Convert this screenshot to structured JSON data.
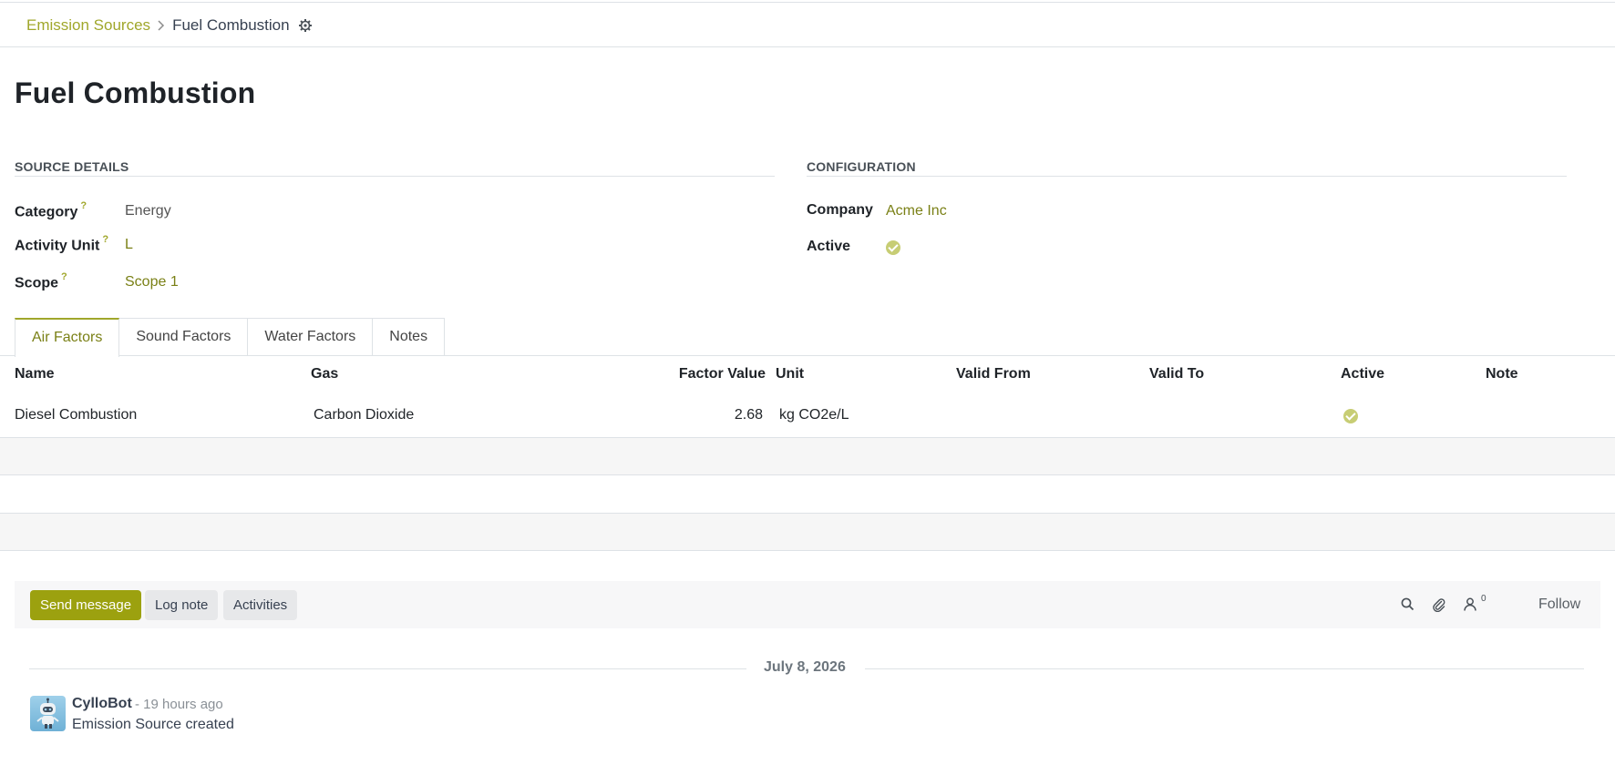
{
  "breadcrumb": {
    "parent": "Emission Sources",
    "current": "Fuel Combustion"
  },
  "title": "Fuel Combustion",
  "source_details": {
    "heading": "SOURCE DETAILS",
    "fields": [
      {
        "label": "Category",
        "help": "?",
        "value": "Energy"
      },
      {
        "label": "Activity Unit",
        "help": "?",
        "value": "L"
      },
      {
        "label": "Scope",
        "help": "?",
        "value": "Scope 1"
      }
    ]
  },
  "configuration": {
    "heading": "CONFIGURATION",
    "company_label": "Company",
    "company_value": "Acme Inc",
    "active_label": "Active",
    "active": true
  },
  "tabs": [
    "Air Factors",
    "Sound Factors",
    "Water Factors",
    "Notes"
  ],
  "active_tab": "Air Factors",
  "table": {
    "columns": [
      "Name",
      "Gas",
      "Factor Value",
      "Unit",
      "Valid From",
      "Valid To",
      "Active",
      "Note"
    ],
    "rows": [
      {
        "name": "Diesel Combustion",
        "gas": "Carbon Dioxide",
        "factor_value": "2.68",
        "unit": "kg CO2e/L",
        "valid_from": "",
        "valid_to": "",
        "active": true,
        "note": ""
      }
    ]
  },
  "chatter": {
    "send_message": "Send message",
    "log_note": "Log note",
    "activities": "Activities",
    "followers_count": "0",
    "follow": "Follow",
    "date_separator": "July 8, 2026",
    "messages": [
      {
        "author": "CylloBot",
        "time": "- 19 hours ago",
        "body": "Emission Source created"
      }
    ]
  },
  "colors": {
    "accent": "#a0a72b",
    "primary_button": "#9ca10f",
    "active_check": "#c7cd74"
  }
}
